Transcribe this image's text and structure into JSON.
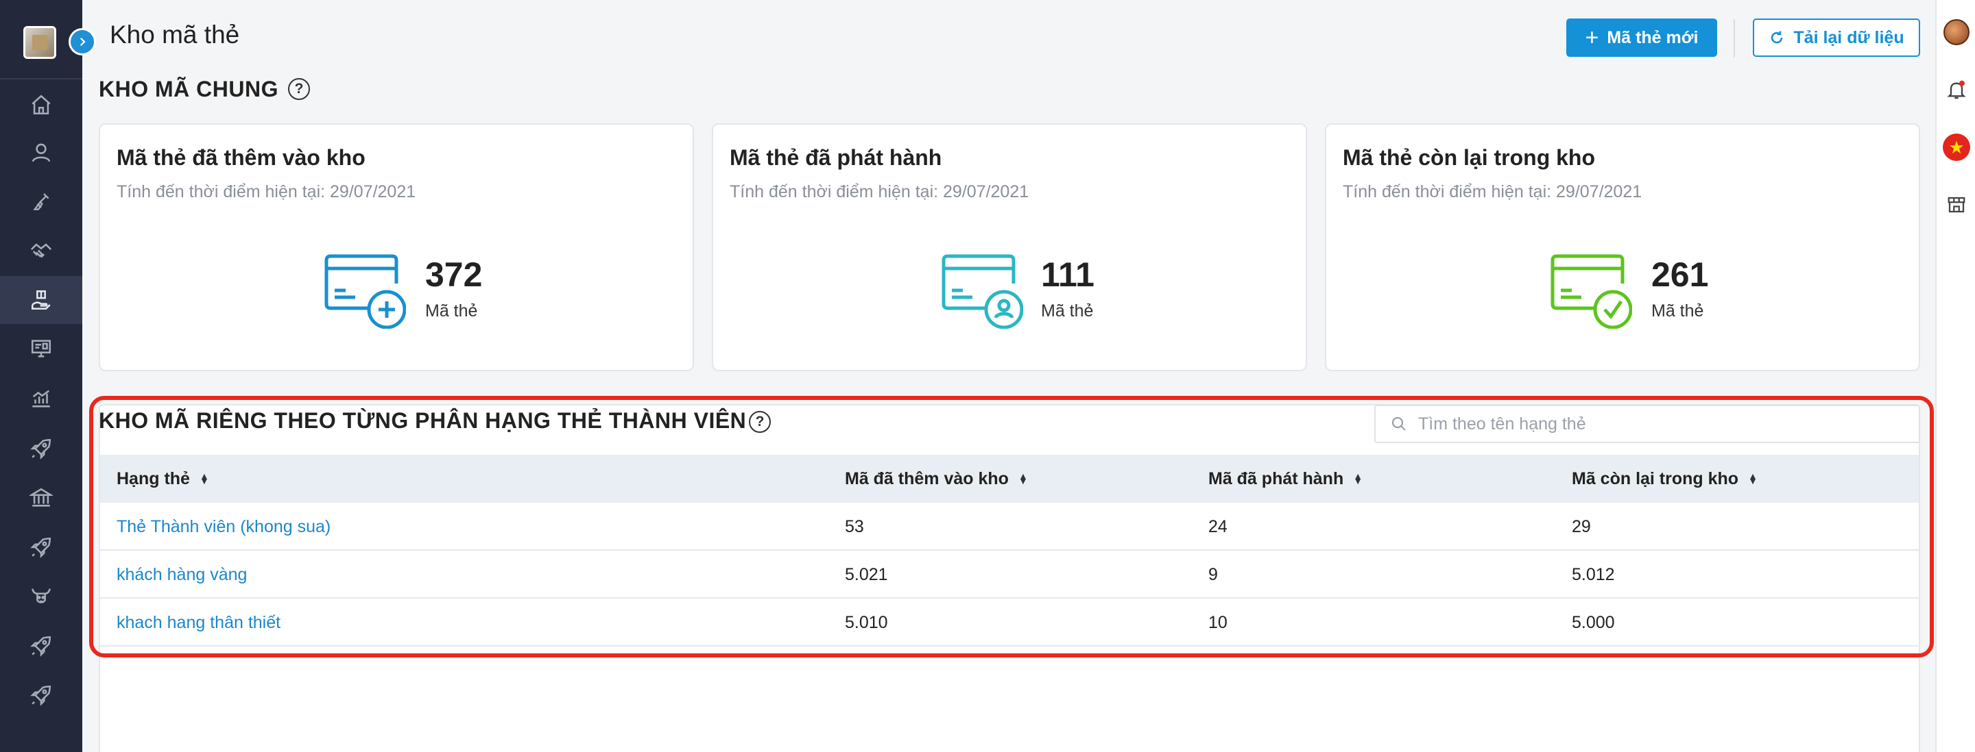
{
  "header": {
    "title": "Kho mã thẻ",
    "new_button_label": "Mã thẻ mới",
    "reload_button_label": "Tải lại dữ liệu"
  },
  "sidebar": {
    "items": [
      {
        "icon": "home-icon"
      },
      {
        "icon": "user-icon"
      },
      {
        "icon": "broom-icon"
      },
      {
        "icon": "handshake-icon"
      },
      {
        "icon": "gift-hand-icon",
        "active": true
      },
      {
        "icon": "monitor-icon"
      },
      {
        "icon": "chart-icon"
      },
      {
        "icon": "rocket-icon"
      },
      {
        "icon": "bank-icon"
      },
      {
        "icon": "rocket-icon"
      },
      {
        "icon": "bull-icon"
      },
      {
        "icon": "rocket-icon"
      },
      {
        "icon": "rocket-icon"
      }
    ]
  },
  "overview": {
    "section_title": "KHO MÃ CHUNG",
    "cards": [
      {
        "title": "Mã thẻ đã thêm vào kho",
        "subtitle": "Tính đến thời điểm hiện tại: 29/07/2021",
        "value": "372",
        "unit": "Mã thẻ",
        "icon": "card-add-icon",
        "color": "#1a8fd0"
      },
      {
        "title": "Mã thẻ đã phát hành",
        "subtitle": "Tính đến thời điểm hiện tại: 29/07/2021",
        "value": "111",
        "unit": "Mã thẻ",
        "icon": "card-user-icon",
        "color": "#2bb6c4"
      },
      {
        "title": "Mã thẻ còn lại trong kho",
        "subtitle": "Tính đến thời điểm hiện tại: 29/07/2021",
        "value": "261",
        "unit": "Mã thẻ",
        "icon": "card-check-icon",
        "color": "#5cc41e"
      }
    ]
  },
  "tiers": {
    "section_title": "KHO MÃ RIÊNG THEO TỪNG PHÂN HẠNG THẺ THÀNH VIÊN",
    "search_placeholder": "Tìm theo tên hạng thẻ",
    "columns": [
      "Hạng thẻ",
      "Mã đã thêm vào kho",
      "Mã đã phát hành",
      "Mã còn lại trong kho"
    ],
    "rows": [
      {
        "name": "Thẻ Thành viên (khong sua)",
        "added": "53",
        "issued": "24",
        "remaining": "29"
      },
      {
        "name": "khách hàng vàng",
        "added": "5.021",
        "issued": "9",
        "remaining": "5.012"
      },
      {
        "name": "khach hang thân thiết",
        "added": "5.010",
        "issued": "10",
        "remaining": "5.000"
      }
    ]
  },
  "colors": {
    "primary": "#1591d7",
    "sidebar_bg": "#23283a",
    "highlight": "#e8291c",
    "link": "#1c87cc"
  }
}
